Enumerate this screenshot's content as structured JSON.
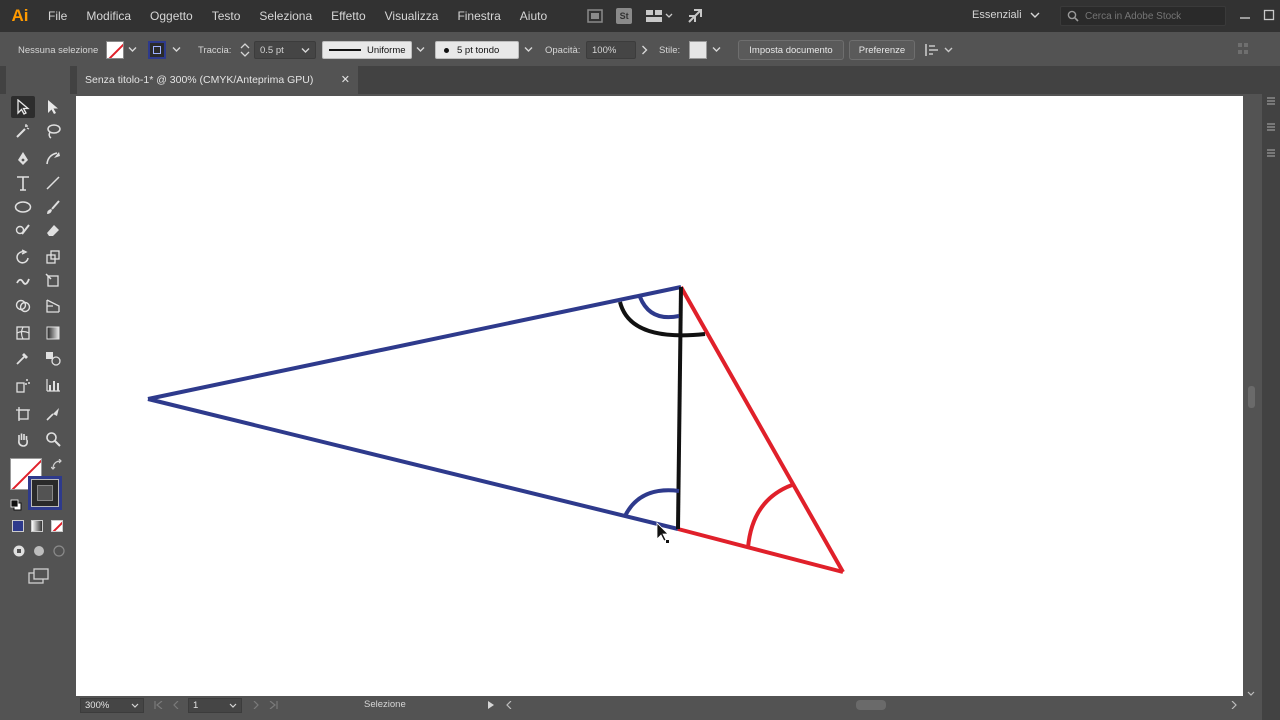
{
  "app": {
    "logo": "Ai",
    "menu": [
      "File",
      "Modifica",
      "Oggetto",
      "Testo",
      "Seleziona",
      "Effetto",
      "Visualizza",
      "Finestra",
      "Aiuto"
    ],
    "stock_badge": "St",
    "workspace": "Essenziali",
    "stock_search_placeholder": "Cerca in Adobe Stock"
  },
  "control_bar": {
    "selection": "Nessuna selezione",
    "stroke_label": "Traccia:",
    "stroke_weight": "0.5 pt",
    "profile": "Uniforme",
    "brush": "5 pt tondo",
    "opacity_label": "Opacità:",
    "opacity_value": "100%",
    "style_label": "Stile:",
    "doc_setup": "Imposta documento",
    "preferences": "Preferenze"
  },
  "document": {
    "tab_title": "Senza titolo-1* @ 300% (CMYK/Anteprima GPU)"
  },
  "status_bar": {
    "zoom": "300%",
    "artboard": "1",
    "tool": "Selezione"
  },
  "colors": {
    "blue_stroke": "#2e3a8c",
    "red_stroke": "#e0202a",
    "black_stroke": "#111111",
    "accent": "#ff9a00"
  },
  "tools": [
    "selection-tool-icon",
    "direct-selection-tool-icon",
    "magic-wand-icon",
    "lasso-icon",
    "pen-icon",
    "curvature-icon",
    "type-icon",
    "line-icon",
    "ellipse-icon",
    "paintbrush-icon",
    "shaper-icon",
    "eraser-icon",
    "rotate-icon",
    "scale-icon",
    "warp-icon",
    "free-transform-icon",
    "shape-builder-icon",
    "perspective-icon",
    "mesh-icon",
    "gradient-icon",
    "eyedropper-icon",
    "blend-icon",
    "symbol-sprayer-icon",
    "graph-icon",
    "artboard-icon",
    "slice-icon",
    "hand-icon",
    "zoom-icon"
  ]
}
